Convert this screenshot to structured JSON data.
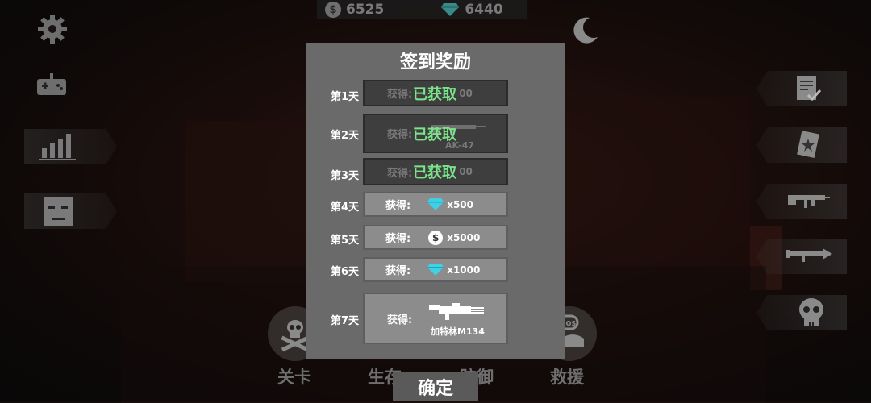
{
  "currency": {
    "coins": "6525",
    "gems": "6440",
    "coin_icon": "dollar-coin-icon",
    "gem_icon": "diamond-icon"
  },
  "dialog": {
    "title": "签到奖励",
    "gain_label": "获得:",
    "claimed_label": "已获取",
    "days": [
      {
        "day": "第1天",
        "status": "claimed",
        "amount": "00"
      },
      {
        "day": "第2天",
        "status": "claimed",
        "item": "AK-47",
        "icon": "rifle-icon"
      },
      {
        "day": "第3天",
        "status": "claimed",
        "amount": "00"
      },
      {
        "day": "第4天",
        "status": "available",
        "icon": "diamond-icon",
        "amount": "x500"
      },
      {
        "day": "第5天",
        "status": "available",
        "icon": "dollar-coin-icon",
        "amount": "x5000"
      },
      {
        "day": "第6天",
        "status": "available",
        "icon": "diamond-icon",
        "amount": "x1000"
      },
      {
        "day": "第7天",
        "status": "available",
        "icon": "minigun-icon",
        "item": "加特林M134"
      }
    ],
    "confirm_label": "确定"
  },
  "modes": [
    {
      "label": "关卡",
      "icon": "skull-crossbones-icon"
    },
    {
      "label": "生存"
    },
    {
      "label": "防御"
    },
    {
      "label": "救援",
      "icon": "sos-icon"
    }
  ],
  "colors": {
    "claimed_green": "#7be38a",
    "gem_cyan": "#3fd0e6",
    "dialog_bg": "#6a6a6a"
  }
}
